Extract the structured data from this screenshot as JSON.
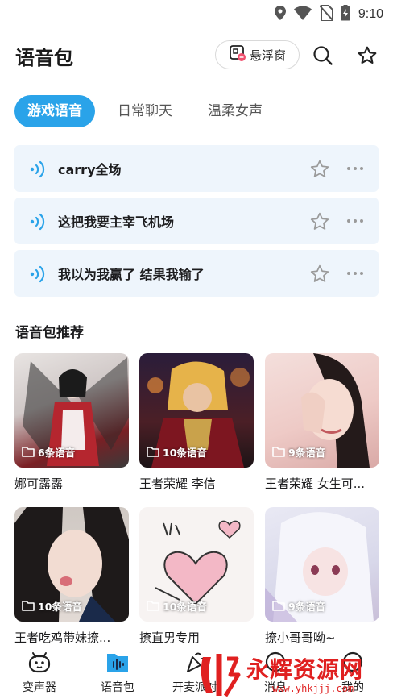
{
  "status_bar": {
    "time": "9:10"
  },
  "header": {
    "title": "语音包",
    "float_button_label": "悬浮窗"
  },
  "tabs": [
    {
      "label": "游戏语音",
      "active": true
    },
    {
      "label": "日常聊天",
      "active": false
    },
    {
      "label": "温柔女声",
      "active": false
    }
  ],
  "voices": [
    {
      "label": "carry全场"
    },
    {
      "label": "这把我要主宰飞机场"
    },
    {
      "label": "我以为我赢了 结果我输了"
    }
  ],
  "section": {
    "title": "语音包推荐"
  },
  "packs": [
    {
      "count": "6条语音",
      "name": "娜可露露"
    },
    {
      "count": "10条语音",
      "name": "王者荣耀 李信"
    },
    {
      "count": "9条语音",
      "name": "王者荣耀 女生可..."
    },
    {
      "count": "10条语音",
      "name": "王者吃鸡带妹撩..."
    },
    {
      "count": "10条语音",
      "name": "撩直男专用"
    },
    {
      "count": "9条语音",
      "name": "撩小哥哥呦~"
    }
  ],
  "bottom_nav": [
    {
      "label": "变声器"
    },
    {
      "label": "语音包"
    },
    {
      "label": "开麦派对"
    },
    {
      "label": "消息"
    },
    {
      "label": "我的"
    }
  ],
  "watermark": {
    "text": "永辉资源网",
    "url": "www.yhkjjj.com"
  },
  "colors": {
    "accent": "#2aa3e9",
    "card_bg": "#eef5fc",
    "watermark": "#e02020"
  }
}
